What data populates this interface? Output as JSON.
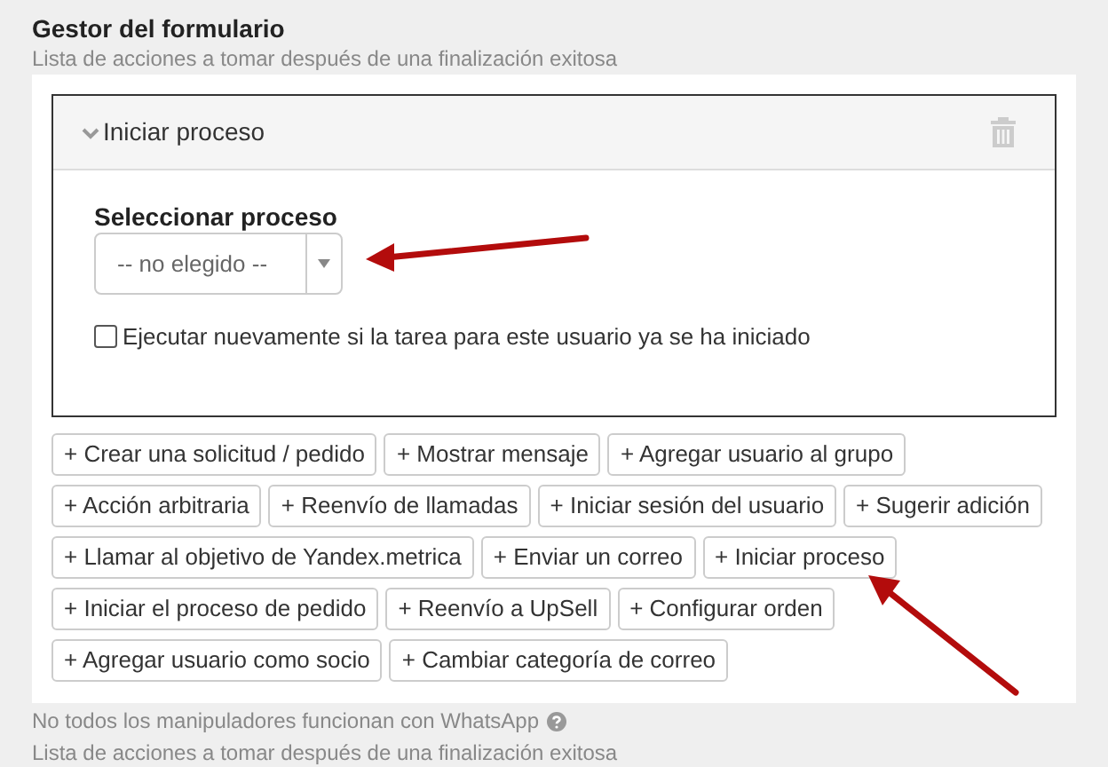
{
  "header": {
    "title": "Gestor del formulario",
    "subtitle": "Lista de acciones a tomar después de una finalización exitosa"
  },
  "action_card": {
    "title": "Iniciar proceso",
    "expanded": true,
    "field_label": "Seleccionar proceso",
    "select_value": "-- no elegido --",
    "checkbox": {
      "label": "Ejecutar nuevamente si la tarea para este usuario ya se ha iniciado",
      "checked": false
    }
  },
  "add_buttons": [
    [
      "+ Crear una solicitud / pedido",
      "+ Mostrar mensaje",
      "+ Agregar usuario al grupo"
    ],
    [
      "+ Acción arbitraria",
      "+ Reenvío de llamadas",
      "+ Iniciar sesión del usuario",
      "+ Sugerir adición"
    ],
    [
      "+ Llamar al objetivo de Yandex.metrica",
      "+ Enviar un correo",
      "+ Iniciar proceso"
    ],
    [
      "+ Iniciar el proceso de pedido",
      "+ Reenvío a UpSell",
      "+ Configurar orden"
    ],
    [
      "+ Agregar usuario como socio",
      "+ Cambiar categoría de correo"
    ]
  ],
  "footer": {
    "note": "No todos los manipuladores funcionan con WhatsApp",
    "subtitle": "Lista de acciones a tomar después de una finalización exitosa"
  }
}
